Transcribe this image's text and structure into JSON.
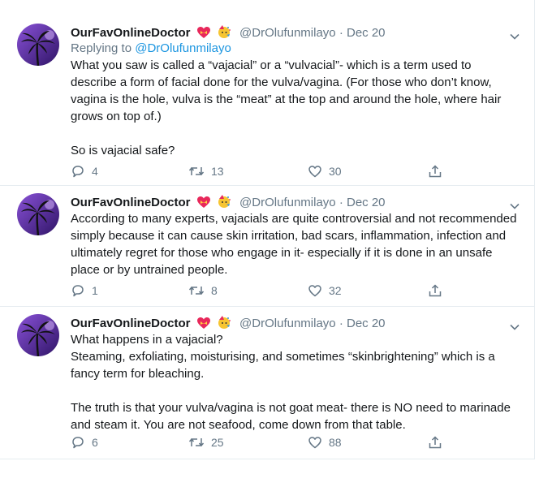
{
  "tweets": [
    {
      "name": "OurFavOnlineDoctor",
      "handle": "@DrOlufunmilayo",
      "separator": "·",
      "date": "Dec 20",
      "replying_prefix": "Replying to ",
      "replying_to": "@DrOlufunmilayo",
      "paragraphs": [
        "What you saw is called a “vajacial” or a “vulvacial”- which is a term used to describe a form of facial done for the vulva/vagina. (For those who don’t know, vagina is the hole, vulva is the “meat” at the top and around the hole, where hair grows on top of.)",
        "So is vajacial safe?"
      ],
      "replies": "4",
      "retweets": "13",
      "likes": "30"
    },
    {
      "name": "OurFavOnlineDoctor",
      "handle": "@DrOlufunmilayo",
      "separator": "·",
      "date": "Dec 20",
      "paragraphs": [
        "According to many experts, vajacials are quite controversial and not recommended simply because it can cause skin irritation, bad scars, inflammation, infection and ultimately regret for those who engage in it- especially if it is done in an unsafe place or by untrained people."
      ],
      "replies": "1",
      "retweets": "8",
      "likes": "32"
    },
    {
      "name": "OurFavOnlineDoctor",
      "handle": "@DrOlufunmilayo",
      "separator": "·",
      "date": "Dec 20",
      "paragraphs": [
        "What happens in a vajacial?",
        "Steaming, exfoliating, moisturising, and sometimes “skinbrightening” which is a fancy term for bleaching.",
        "The truth is that your vulva/vagina is not goat meat- there is NO need to marinade and steam it. You are not seafood, come down from that table."
      ],
      "replies": "6",
      "retweets": "25",
      "likes": "88"
    }
  ],
  "icons": {
    "avatar": "palm-tree-avatar-icon",
    "emoji_1": "heart-with-ribbon-icon",
    "emoji_2": "party-face-icon",
    "menu": "chevron-down-icon",
    "reply": "reply-icon",
    "retweet": "retweet-icon",
    "like": "heart-icon",
    "share": "share-icon"
  },
  "colors": {
    "text": "#14171a",
    "secondary": "#657786",
    "link": "#1b95e0",
    "border": "#e6ecf0",
    "avatar_sky": "#5a2b9c"
  }
}
